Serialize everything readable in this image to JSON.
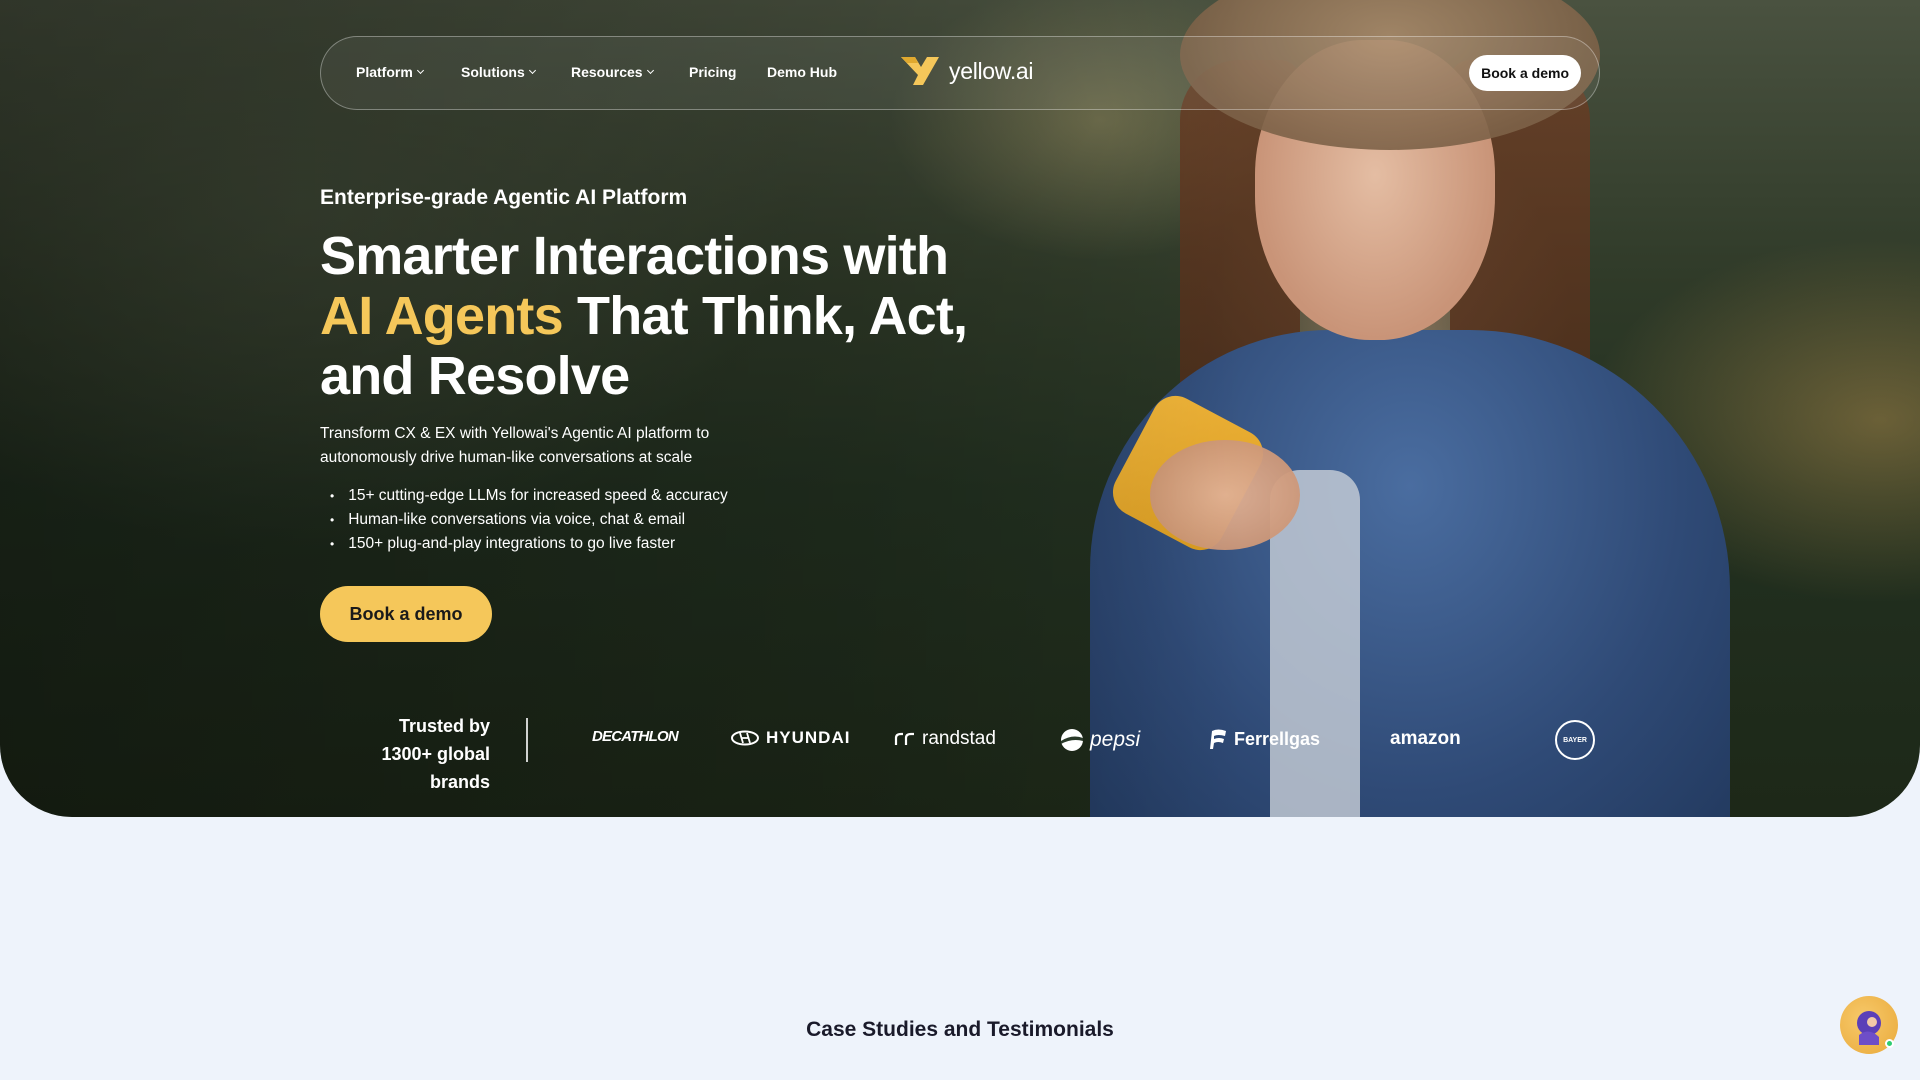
{
  "nav": {
    "items": [
      {
        "label": "Platform",
        "dropdown": true
      },
      {
        "label": "Solutions",
        "dropdown": true
      },
      {
        "label": "Resources",
        "dropdown": true
      },
      {
        "label": "Pricing",
        "dropdown": false
      },
      {
        "label": "Demo Hub",
        "dropdown": false
      }
    ],
    "logo_text": "yellow.ai",
    "cta_label": "Book a demo"
  },
  "hero": {
    "eyebrow": "Enterprise-grade Agentic AI Platform",
    "headline_1": "Smarter Interactions with",
    "headline_highlight": "AI Agents",
    "headline_2": " That Think, Act,",
    "headline_3": "and Resolve",
    "description": "Transform CX & EX with Yellowai's Agentic AI platform to autonomously drive human-like conversations at scale",
    "bullets": [
      "15+ cutting-edge LLMs for increased speed & accuracy",
      "Human-like conversations via voice, chat & email",
      "150+ plug-and-play integrations to go live faster"
    ],
    "cta_label": "Book a demo"
  },
  "trusted": {
    "line1": "Trusted by",
    "line2": "1300+ global brands",
    "brands": [
      "DECATHLON",
      "HYUNDAI",
      "randstad",
      "pepsi",
      "Ferrellgas",
      "amazon",
      "BAYER"
    ]
  },
  "section": {
    "title": "Case Studies and Testimonials"
  },
  "colors": {
    "accent_yellow": "#f5c75a",
    "page_bg": "#eef3fb",
    "dark_text": "#1a1a2a"
  },
  "icons": [
    "chevron-down-icon",
    "yellow-ai-logo-icon",
    "chat-assistant-icon"
  ]
}
